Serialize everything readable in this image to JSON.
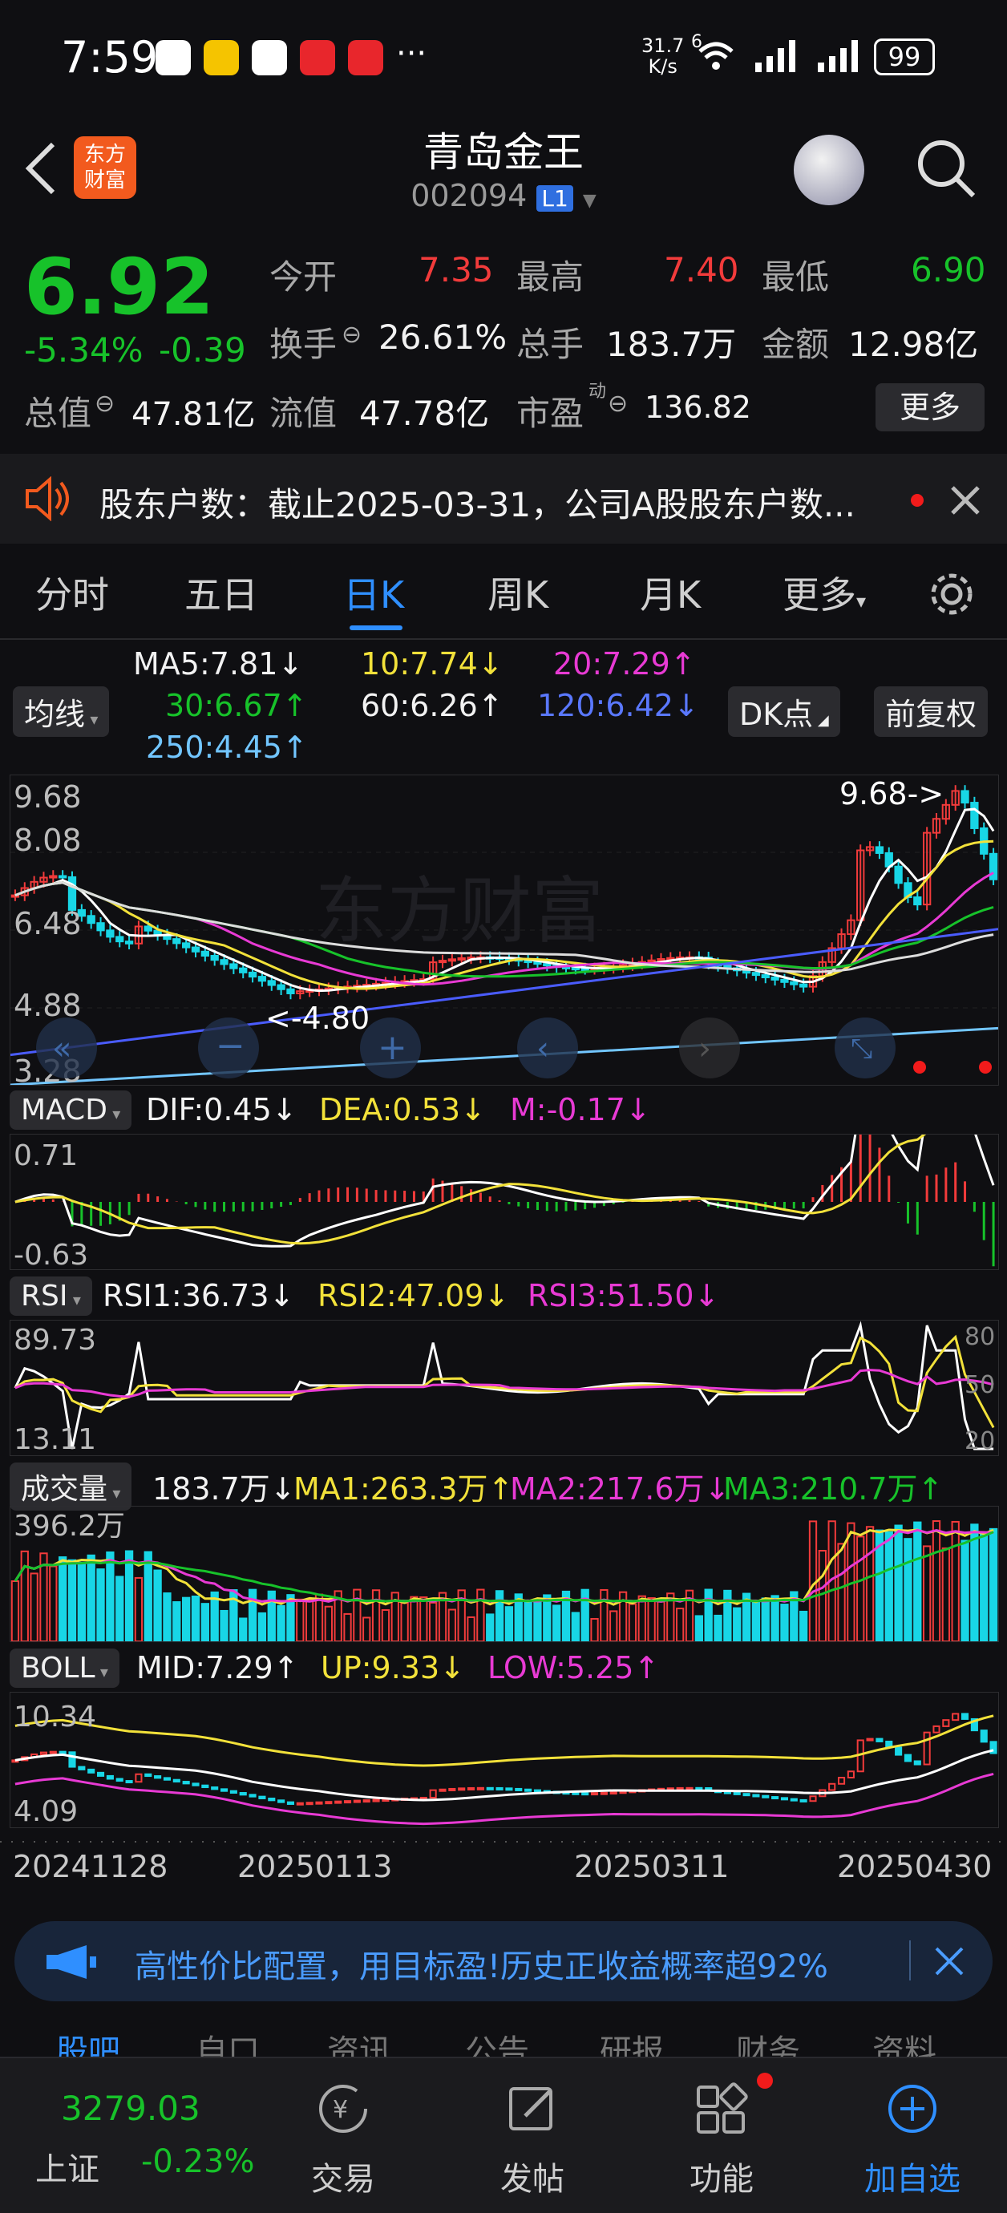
{
  "status_bar": {
    "time": "7:59",
    "speed_value": "31.7",
    "speed_unit": "K/s",
    "network": "6",
    "battery": "99",
    "more": "···"
  },
  "header": {
    "title": "青岛金王",
    "code": "002094",
    "market_badge": "L1",
    "brand_line1": "东方",
    "brand_line2": "财富"
  },
  "quote": {
    "price": "6.92",
    "change_pct": "-5.34%",
    "change_abs": "-0.39",
    "open_label": "今开",
    "open": "7.35",
    "high_label": "最高",
    "high": "7.40",
    "low_label": "最低",
    "low": "6.90",
    "turnover_label": "换手",
    "turnover": "26.61%",
    "volume_label": "总手",
    "volume": "183.7万",
    "amount_label": "金额",
    "amount": "12.98亿",
    "mktcap_label": "总值",
    "mktcap": "47.81亿",
    "float_label": "流值",
    "float": "47.78亿",
    "pe_label": "市盈",
    "pe_sup": "动",
    "pe": "136.82",
    "more": "更多"
  },
  "notice": {
    "text": "股东户数：截止2025-03-31，公司A股股东户数..."
  },
  "tabs": [
    "分时",
    "五日",
    "日K",
    "周K",
    "月K",
    "更多"
  ],
  "active_tab": 2,
  "ma": {
    "ma5": "MA5:7.81↓",
    "ma10": "10:7.74↓",
    "ma20": "20:7.29↑",
    "ma30": "30:6.67↑",
    "ma60": "60:6.26↑",
    "ma120": "120:6.42↓",
    "ma250": "250:4.45↑",
    "select": "均线",
    "dk": "DK点",
    "fq": "前复权"
  },
  "kline": {
    "max_label": "9.68",
    "l2": "8.08",
    "l3": "6.48",
    "l4": "4.88",
    "min_label": "3.28",
    "hi_marker": "9.68->",
    "lo_marker": "<-4.80",
    "watermark": "东方财富"
  },
  "macd": {
    "select": "MACD",
    "dif": "DIF:0.45↓",
    "dea": "DEA:0.53↓",
    "m": "M:-0.17↓",
    "top": "0.71",
    "bottom": "-0.63"
  },
  "rsi": {
    "select": "RSI",
    "rsi1": "RSI1:36.73↓",
    "rsi2": "RSI2:47.09↓",
    "rsi3": "RSI3:51.50↓",
    "top": "89.73",
    "bottom": "13.11",
    "r80": "80",
    "r50": "50",
    "r20": "20"
  },
  "vol": {
    "select": "成交量",
    "vol": "183.7万↓",
    "ma1": "MA1:263.3万↑",
    "ma2": "MA2:217.6万↓",
    "ma3": "MA3:210.7万↑",
    "top": "396.2万"
  },
  "boll": {
    "select": "BOLL",
    "mid": "MID:7.29↑",
    "up": "UP:9.33↓",
    "low": "LOW:5.25↑",
    "top": "10.34",
    "bottom": "4.09"
  },
  "dates": [
    "20241128",
    "20250113",
    "20250311",
    "20250430"
  ],
  "banner": {
    "text": "高性价比配置，用目标盈!历史正收益概率超92%"
  },
  "bottom_nav": {
    "index_value": "3279.03",
    "index_name": "上证",
    "index_change": "-0.23%",
    "trade": "交易",
    "post": "发帖",
    "func": "功能",
    "add": "加自选",
    "peek": [
      "股吧",
      "自口",
      "资讯",
      "公告",
      "研报",
      "财务",
      "资料"
    ]
  },
  "colors": {
    "up": "#f23b3b",
    "down": "#17c22a",
    "accent": "#2f8fff",
    "ma5": "#ffffff",
    "ma10": "#f2e13a",
    "ma20": "#e83ad4",
    "ma30": "#17c22a",
    "ma60": "#dddddd",
    "ma120": "#4a5cff",
    "ma250": "#72c6ff"
  },
  "chart_data": {
    "type": "line",
    "title": "",
    "x": [
      "20241128",
      "20250113",
      "20250311",
      "20250430"
    ],
    "ylim": [
      3.28,
      9.68
    ],
    "series": [
      {
        "name": "MA5",
        "values": [
          6.6,
          5.2,
          5.8,
          7.81
        ]
      },
      {
        "name": "10",
        "values": [
          6.7,
          5.3,
          5.8,
          7.74
        ]
      },
      {
        "name": "20",
        "values": [
          6.9,
          5.5,
          5.9,
          7.29
        ]
      },
      {
        "name": "30",
        "values": [
          6.8,
          5.7,
          5.9,
          6.67
        ]
      },
      {
        "name": "60",
        "values": [
          6.0,
          6.3,
          6.1,
          6.26
        ]
      },
      {
        "name": "120",
        "values": [
          4.2,
          4.8,
          5.6,
          6.42
        ]
      },
      {
        "name": "250",
        "values": [
          3.3,
          3.7,
          4.0,
          4.45
        ]
      }
    ]
  }
}
